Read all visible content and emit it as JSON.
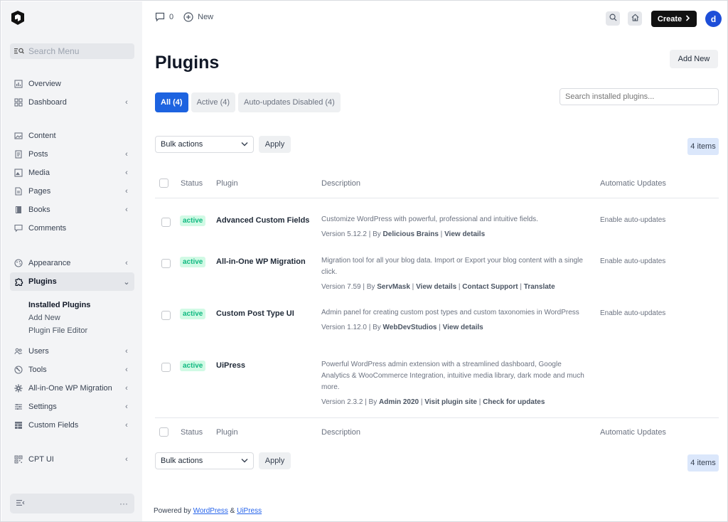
{
  "sidebar": {
    "search_placeholder": "Search Menu",
    "groups": [
      [
        {
          "label": "Overview",
          "icon": "chart-icon",
          "chevron": ""
        },
        {
          "label": "Dashboard",
          "icon": "grid-icon",
          "chevron": "‹"
        }
      ],
      [
        {
          "label": "Content",
          "icon": "images-icon",
          "chevron": ""
        },
        {
          "label": "Posts",
          "icon": "document-icon",
          "chevron": "‹"
        },
        {
          "label": "Media",
          "icon": "image-icon",
          "chevron": "‹"
        },
        {
          "label": "Pages",
          "icon": "page-icon",
          "chevron": "‹"
        },
        {
          "label": "Books",
          "icon": "book-icon",
          "chevron": "‹"
        },
        {
          "label": "Comments",
          "icon": "comment-icon",
          "chevron": ""
        }
      ],
      [
        {
          "label": "Appearance",
          "icon": "palette-icon",
          "chevron": "‹"
        },
        {
          "label": "Plugins",
          "icon": "puzzle-icon",
          "chevron": "⌄"
        }
      ]
    ],
    "plugins_submenu": [
      "Installed Plugins",
      "Add New",
      "Plugin File Editor"
    ],
    "after_groups": [
      {
        "label": "Users",
        "icon": "users-icon",
        "chevron": "‹"
      },
      {
        "label": "Tools",
        "icon": "tools-icon",
        "chevron": "‹"
      },
      {
        "label": "All-in-One WP Migration",
        "icon": "gear-icon",
        "chevron": "‹"
      },
      {
        "label": "Settings",
        "icon": "sliders-icon",
        "chevron": "‹"
      },
      {
        "label": "Custom Fields",
        "icon": "table-icon",
        "chevron": "‹"
      }
    ],
    "last_group": [
      {
        "label": "CPT UI",
        "icon": "qr-icon",
        "chevron": "‹"
      }
    ],
    "bottom_more": "···"
  },
  "topbar": {
    "comments_count": "0",
    "new_label": "New",
    "create_label": "Create",
    "avatar_letter": "d"
  },
  "page": {
    "title": "Plugins",
    "add_new": "Add New",
    "filters": [
      "All (4)",
      "Active (4)",
      "Auto-updates Disabled (4)"
    ],
    "search_placeholder": "Search installed plugins...",
    "bulk_actions": "Bulk actions",
    "apply": "Apply",
    "items_count": "4 items"
  },
  "table": {
    "headers": {
      "status": "Status",
      "plugin": "Plugin",
      "description": "Description",
      "auto": "Automatic Updates"
    },
    "rows": [
      {
        "status": "active",
        "name": "Advanced Custom Fields",
        "description": "Customize WordPress with powerful, professional and intuitive fields.",
        "version": "Version 5.12.2 | By",
        "author": "Delicious Brains",
        "links": [
          "View details"
        ],
        "auto": "Enable auto-updates"
      },
      {
        "status": "active",
        "name": "All-in-One WP Migration",
        "description": "Migration tool for all your blog data. Import or Export your blog content with a single click.",
        "version": "Version 7.59 | By",
        "author": "ServMask",
        "links": [
          "View details",
          "Contact Support",
          "Translate"
        ],
        "auto": "Enable auto-updates"
      },
      {
        "status": "active",
        "name": "Custom Post Type UI",
        "description": "Admin panel for creating custom post types and custom taxonomies in WordPress",
        "version": "Version 1.12.0 | By",
        "author": "WebDevStudios",
        "links": [
          "View details"
        ],
        "auto": "Enable auto-updates"
      },
      {
        "status": "active",
        "name": "UiPress",
        "description": "Powerful WordPress admin extension with a streamlined dashboard, Google Analytics & WooCommerce Integration, intuitive media library, dark mode and much more.",
        "version": "Version 2.3.2 | By",
        "author": "Admin 2020",
        "links": [
          "Visit plugin site",
          "Check for updates"
        ],
        "auto": ""
      }
    ]
  },
  "footer": {
    "prefix": "Powered by",
    "link1": "WordPress",
    "amp": "&",
    "link2": "UiPress"
  },
  "colors": {
    "accent": "#1d63e0",
    "active_pill_bg": "#d1fae5",
    "active_pill_text": "#10b981",
    "create_bg": "#111111"
  }
}
